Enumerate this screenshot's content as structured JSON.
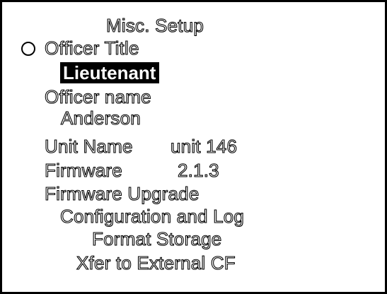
{
  "header": {
    "title": "Misc. Setup"
  },
  "menu": {
    "officer_title_label": "Officer Title",
    "officer_title_value": "Lieutenant",
    "officer_name_label": "Officer name",
    "officer_name_value": "Anderson",
    "unit_name_label": "Unit Name",
    "unit_name_value": "unit 146",
    "firmware_label": "Firmware",
    "firmware_value": "2.1.3",
    "firmware_upgrade": "Firmware Upgrade",
    "config_and_log": "Configuration and Log",
    "format_storage": "Format Storage",
    "xfer_external": "Xfer to External CF"
  },
  "cursor_icon": "circle-cursor-icon"
}
